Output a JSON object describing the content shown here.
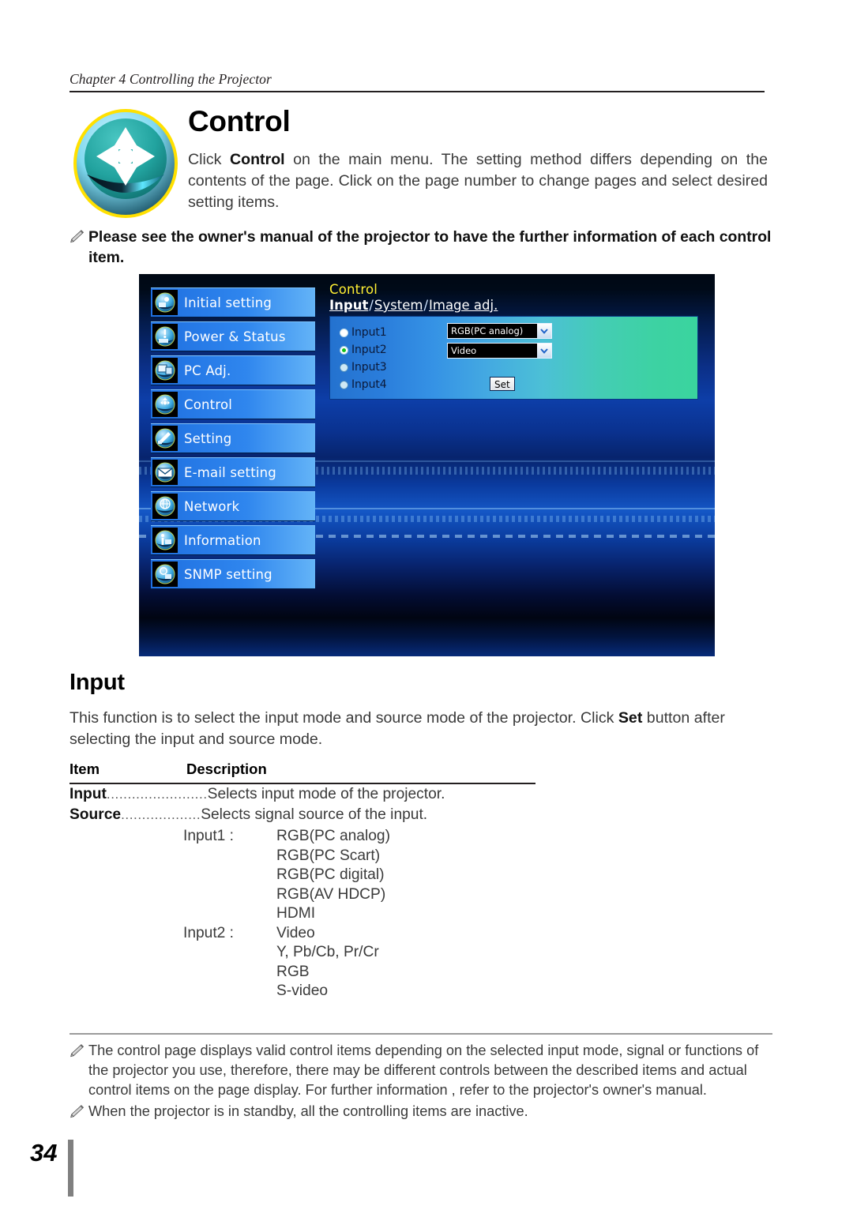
{
  "header": {
    "chapter": "Chapter 4 Controlling the Projector"
  },
  "section": {
    "title": "Control",
    "badge_icon": "dpad-control-icon",
    "intro_pre": "Click ",
    "intro_bold": "Control",
    "intro_post": " on the main menu. The setting method differs depending on the contents of the page. Click on the page number to change pages and select desired setting items."
  },
  "note_top": {
    "icon": "pencil-icon",
    "text": "Please see the owner's manual of the projector to have the further information of each control item."
  },
  "screenshot": {
    "sidebar": [
      {
        "label": "Initial setting",
        "icon": "initial-setting-icon"
      },
      {
        "label": "Power & Status",
        "icon": "power-status-icon"
      },
      {
        "label": "PC Adj.",
        "icon": "pc-adj-icon"
      },
      {
        "label": "Control",
        "icon": "control-icon"
      },
      {
        "label": "Setting",
        "icon": "setting-icon"
      },
      {
        "label": "E-mail setting",
        "icon": "email-setting-icon"
      },
      {
        "label": "Network",
        "icon": "network-icon"
      },
      {
        "label": "Information",
        "icon": "information-icon"
      },
      {
        "label": "SNMP setting",
        "icon": "snmp-setting-icon"
      }
    ],
    "content_title": "Control",
    "tabs": [
      {
        "label": "Input",
        "selected": true
      },
      {
        "label": "System",
        "selected": false
      },
      {
        "label": "Image adj.",
        "selected": false
      }
    ],
    "tab_separator": "/",
    "radios": [
      {
        "label": "Input1",
        "state": "filled-white"
      },
      {
        "label": "Input2",
        "state": "selected-green"
      },
      {
        "label": "Input3",
        "state": "empty"
      },
      {
        "label": "Input4",
        "state": "empty"
      }
    ],
    "selects": [
      {
        "value": "RGB(PC analog)"
      },
      {
        "value": "Video"
      }
    ],
    "set_button": "Set",
    "colors": {
      "title_yellow": "#ffef33",
      "panel_left": "#2472cf",
      "panel_right": "#3ad49e",
      "menu_blue": "#2f86ee",
      "radio_green": "#12c21a"
    }
  },
  "input_section": {
    "heading": "Input",
    "paragraph_pre": "This function is to select the input mode and source mode of the projector.  Click ",
    "paragraph_bold": "Set",
    "paragraph_post": " button after selecting the input and source mode.",
    "table": {
      "columns": [
        "Item",
        "Description"
      ],
      "rows": [
        {
          "item": "Input",
          "leader": "........................",
          "desc": "Selects input mode of the projector."
        },
        {
          "item": "Source",
          "leader": " ...................",
          "desc": "Selects signal source of the input."
        }
      ],
      "sources": [
        {
          "label": "Input1 :",
          "value": "RGB(PC analog)"
        },
        {
          "label": "",
          "value": "RGB(PC Scart)"
        },
        {
          "label": "",
          "value": "RGB(PC digital)"
        },
        {
          "label": "",
          "value": "RGB(AV HDCP)"
        },
        {
          "label": "",
          "value": "HDMI"
        },
        {
          "label": "Input2 :",
          "value": "Video"
        },
        {
          "label": "",
          "value": "Y, Pb/Cb, Pr/Cr"
        },
        {
          "label": "",
          "value": "RGB"
        },
        {
          "label": "",
          "value": "S-video"
        }
      ]
    }
  },
  "footer_notes": [
    {
      "icon": "pencil-icon",
      "text": "The control page displays valid control items depending on the selected input mode, signal or  functions of the projector you use, therefore, there may be different controls between the described items and actual control items on the page display. For further information , refer to the projector's owner's manual."
    },
    {
      "icon": "pencil-icon",
      "text": "When the projector is in standby, all the controlling items are inactive."
    }
  ],
  "page_number": "34"
}
